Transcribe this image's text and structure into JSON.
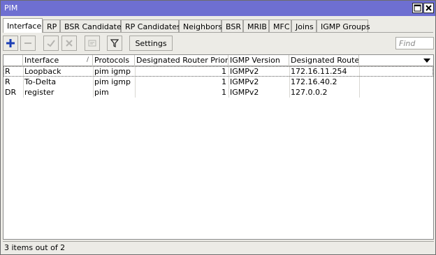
{
  "window": {
    "title": "PIM"
  },
  "tabs": [
    {
      "label": "Interface",
      "active": true
    },
    {
      "label": "RP"
    },
    {
      "label": "BSR Candidates"
    },
    {
      "label": "RP Candidates"
    },
    {
      "label": "Neighbors"
    },
    {
      "label": "BSR"
    },
    {
      "label": "MRIB"
    },
    {
      "label": "MFC"
    },
    {
      "label": "Joins"
    },
    {
      "label": "IGMP Groups"
    }
  ],
  "toolbar": {
    "buttons": [
      "add-icon",
      "remove-icon",
      "enable-icon",
      "disable-icon",
      "comment-icon",
      "filter-icon"
    ],
    "settings_label": "Settings",
    "find_placeholder": "Find",
    "accent": "#1c3fb5"
  },
  "table": {
    "columns": [
      "",
      "Interface",
      "Protocols",
      "Designated Router Priority",
      "IGMP Version",
      "Designated Router"
    ],
    "sort_indicator": "/",
    "rows": [
      {
        "flag": "R",
        "interface": "Loopback",
        "protocols": "pim igmp",
        "priority": "1",
        "igmp_version": "IGMPv2",
        "dr": "172.16.11.254"
      },
      {
        "flag": "R",
        "interface": "To-Delta",
        "protocols": "pim igmp",
        "priority": "1",
        "igmp_version": "IGMPv2",
        "dr": "172.16.40.2"
      },
      {
        "flag": "DR",
        "interface": "register",
        "protocols": "pim",
        "priority": "1",
        "igmp_version": "IGMPv2",
        "dr": "127.0.0.2"
      }
    ]
  },
  "status": {
    "text": "3 items out of 2"
  }
}
